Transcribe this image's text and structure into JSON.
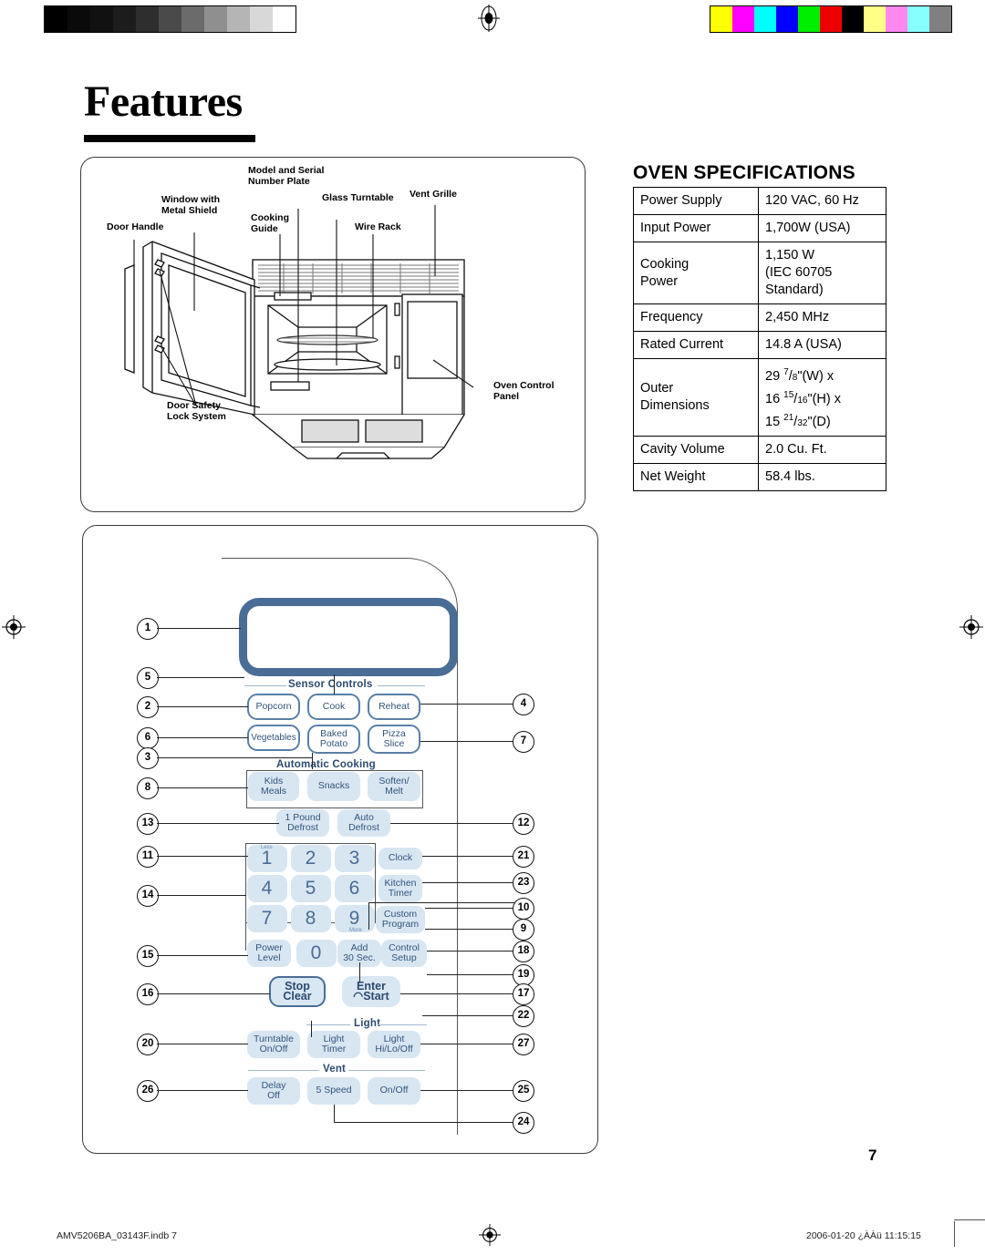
{
  "page": {
    "title": "Features",
    "number": "7"
  },
  "footer": {
    "left": "AMV5206BA_03143F.indb   7",
    "right": "2006-01-20   ¿ÀÀü 11:15:15"
  },
  "print_strip": {
    "grayscale": [
      "#000000",
      "#0a0a0a",
      "#111111",
      "#1c1c1c",
      "#2e2e2e",
      "#4a4a4a",
      "#6b6b6b",
      "#8f8f8f",
      "#b5b5b5",
      "#d8d8d8",
      "#ffffff"
    ],
    "colors": [
      "#ffff00",
      "#ff00ff",
      "#00ffff",
      "#0000ff",
      "#00ee00",
      "#ee0000",
      "#000000",
      "#ffff88",
      "#ff88ee",
      "#88ffff",
      "#808080"
    ]
  },
  "illustration": {
    "labels": [
      {
        "text": "Door Handle"
      },
      {
        "text": "Window with\nMetal Shield"
      },
      {
        "text": "Model and Serial\nNumber Plate"
      },
      {
        "text": "Cooking\nGuide"
      },
      {
        "text": "Glass Turntable"
      },
      {
        "text": "Wire Rack"
      },
      {
        "text": "Vent Grille"
      },
      {
        "text": "Oven Control\nPanel"
      },
      {
        "text": "Door Safety\nLock System"
      }
    ]
  },
  "specs": {
    "title": "OVEN SPECIFICATIONS",
    "rows": [
      {
        "key": "Power Supply",
        "value": "120 VAC, 60 Hz"
      },
      {
        "key": "Input Power",
        "value": "1,700W (USA)"
      },
      {
        "key": "Cooking\nPower",
        "value": "1,150 W\n(IEC 60705\nStandard)"
      },
      {
        "key": "Frequency",
        "value": "2,450 MHz"
      },
      {
        "key": "Rated Current",
        "value": "14.8 A (USA)"
      },
      {
        "key": "Outer\nDimensions",
        "value": "29 7/8\"(W) x 16 15/16\"(H) x 15 21/32\"(D)"
      },
      {
        "key": "Cavity Volume",
        "value": "2.0 Cu. Ft."
      },
      {
        "key": "Net Weight",
        "value": "58.4 lbs."
      }
    ]
  },
  "control_panel": {
    "captions": {
      "sensor": "Sensor Controls",
      "automatic": "Automatic Cooking",
      "light": "Light",
      "vent": "Vent"
    },
    "buttons": {
      "popcorn": "Popcorn",
      "cook": "Cook",
      "reheat": "Reheat",
      "vegetables": "Vegetables",
      "baked_potato": "Baked\nPotato",
      "pizza_slice": "Pizza\nSlice",
      "kids_meals": "Kids\nMeals",
      "snacks": "Snacks",
      "soften_melt": "Soften/\nMelt",
      "one_pound_defrost": "1 Pound\nDefrost",
      "auto_defrost": "Auto\nDefrost",
      "num1": "1",
      "num2": "2",
      "num3": "3",
      "num4": "4",
      "num5": "5",
      "num6": "6",
      "num7": "7",
      "num8": "8",
      "num9": "9",
      "num0": "0",
      "less": "Less",
      "more": "More",
      "clock": "Clock",
      "kitchen_timer": "Kitchen\nTimer",
      "custom_program": "Custom\nProgram",
      "power_level": "Power\nLevel",
      "add_30_sec": "Add\n30 Sec.",
      "control_setup": "Control\nSetup",
      "stop_clear": "Stop\nClear",
      "enter_start": "Enter\n◠Start",
      "turntable_onoff": "Turntable\nOn/Off",
      "light_timer": "Light\nTimer",
      "light_hilooff": "Light\nHi/Lo/Off",
      "delay_off": "Delay\nOff",
      "five_speed": "5 Speed",
      "vent_onoff": "On/Off"
    },
    "callouts_left": [
      "1",
      "5",
      "2",
      "6",
      "3",
      "8",
      "13",
      "11",
      "14",
      "15",
      "16",
      "20",
      "26"
    ],
    "callouts_right": [
      "4",
      "7",
      "12",
      "21",
      "23",
      "10",
      "9",
      "18",
      "19",
      "17",
      "22",
      "27",
      "25",
      "24"
    ]
  }
}
